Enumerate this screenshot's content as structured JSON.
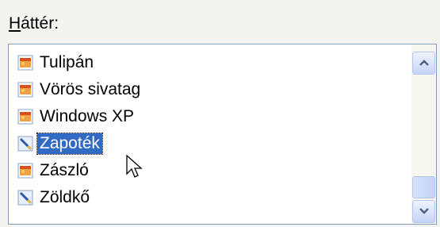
{
  "field_label": "Háttér:",
  "items": [
    {
      "label": "Tulipán",
      "icon": "image-file-icon"
    },
    {
      "label": "Vörös sivatag",
      "icon": "image-file-icon"
    },
    {
      "label": "Windows XP",
      "icon": "image-file-icon"
    },
    {
      "label": "Zapoték",
      "icon": "brush-icon",
      "selected": true
    },
    {
      "label": "Zászló",
      "icon": "image-file-icon"
    },
    {
      "label": "Zöldkő",
      "icon": "brush-icon"
    }
  ],
  "colors": {
    "selection": "#316ac5",
    "border": "#7f9db9"
  }
}
